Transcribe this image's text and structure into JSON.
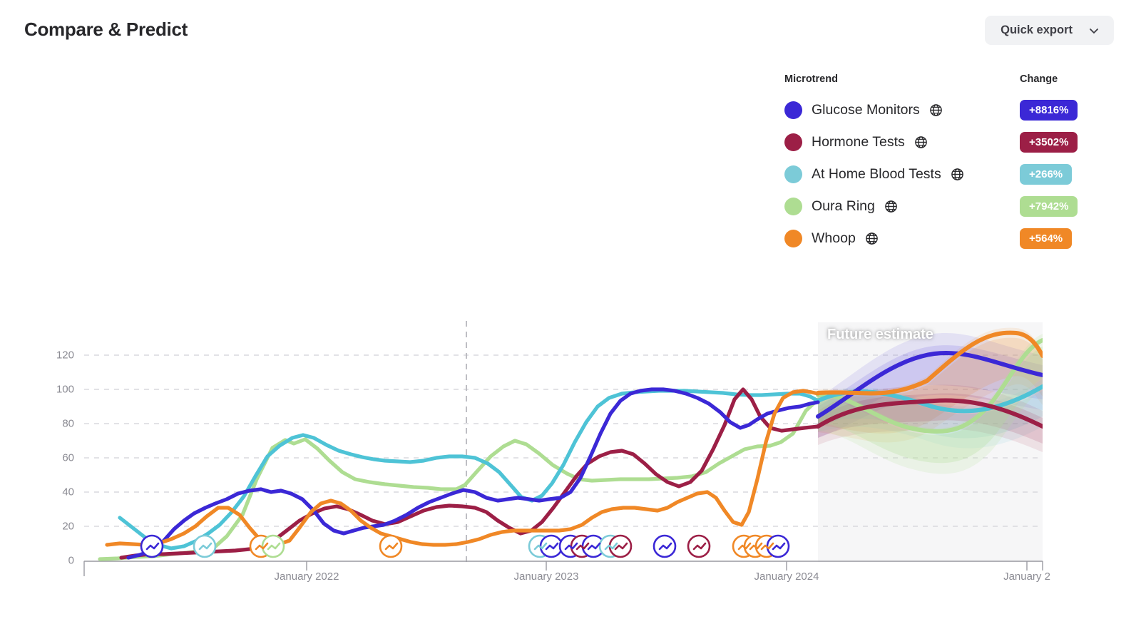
{
  "header": {
    "title": "Compare & Predict",
    "export_label": "Quick export",
    "export_icon": "chevron-down-icon"
  },
  "legend": {
    "col_trend": "Microtrend",
    "col_change": "Change",
    "globe_icon": "globe-icon",
    "items": [
      {
        "label": "Glucose Monitors",
        "color": "#3b28d6",
        "change": "+8816%",
        "chip_text_color": "#ffffff"
      },
      {
        "label": "Hormone Tests",
        "color": "#9c1f46",
        "change": "+3502%",
        "chip_text_color": "#ffffff"
      },
      {
        "label": "At Home Blood Tests",
        "color": "#7ccbd8",
        "change": "+266%",
        "chip_text_color": "#ffffff"
      },
      {
        "label": "Oura Ring",
        "color": "#aedd92",
        "change": "+7942%",
        "chip_text_color": "#ffffff"
      },
      {
        "label": "Whoop",
        "color": "#f08826",
        "change": "+564%",
        "chip_text_color": "#ffffff"
      }
    ]
  },
  "chart_data": {
    "type": "line",
    "title": "",
    "xlabel": "",
    "ylabel": "",
    "ylim": [
      0,
      130
    ],
    "yticks": [
      0,
      20,
      40,
      60,
      80,
      100,
      120
    ],
    "xticks": [
      "January 2022",
      "January 2023",
      "January 2024",
      "January 2"
    ],
    "grid": true,
    "legend_position": "top-right",
    "annotations": [
      {
        "text": "Future estimate",
        "type": "region-label"
      },
      {
        "text": "",
        "type": "vertical-dashed-marker"
      }
    ],
    "forecast_start": "mid 2024",
    "x": [
      "2021-06",
      "2021-07",
      "2021-08",
      "2021-09",
      "2021-10",
      "2021-11",
      "2021-12",
      "2022-01",
      "2022-02",
      "2022-03",
      "2022-04",
      "2022-05",
      "2022-06",
      "2022-07",
      "2022-08",
      "2022-09",
      "2022-10",
      "2022-11",
      "2022-12",
      "2023-01",
      "2023-02",
      "2023-03",
      "2023-04",
      "2023-05",
      "2023-06",
      "2023-07",
      "2023-08",
      "2023-09",
      "2023-10",
      "2023-11",
      "2023-12",
      "2024-01",
      "2024-02",
      "2024-03",
      "2024-04",
      "2024-05",
      "2024-06",
      "2024-07",
      "2024-08",
      "2024-09",
      "2024-10",
      "2024-11",
      "2024-12",
      "2025-01"
    ],
    "series": [
      {
        "name": "Glucose Monitors",
        "color": "#3b28d6",
        "values": [
          3,
          6,
          12,
          22,
          30,
          33,
          33,
          26,
          14,
          9,
          13,
          19,
          17,
          15,
          17,
          26,
          40,
          44,
          46,
          41,
          39,
          38,
          41,
          38,
          38,
          60,
          88,
          96,
          97,
          96,
          92,
          83,
          75,
          78,
          90,
          92,
          88,
          99,
          108,
          118,
          121,
          118,
          107,
          105
        ],
        "forecast_from": 36
      },
      {
        "name": "Hormone Tests",
        "color": "#9c1f46",
        "values": [
          2,
          4,
          4,
          5,
          6,
          6,
          7,
          6,
          6,
          8,
          12,
          18,
          24,
          27,
          30,
          26,
          22,
          20,
          18,
          17,
          19,
          20,
          17,
          12,
          11,
          18,
          30,
          52,
          68,
          72,
          66,
          52,
          47,
          65,
          88,
          100,
          82,
          78,
          92,
          97,
          100,
          97,
          95,
          86
        ],
        "forecast_from": 36
      },
      {
        "name": "At Home Blood Tests",
        "color": "#7ccbd8",
        "values": [
          25,
          18,
          12,
          13,
          16,
          21,
          26,
          30,
          45,
          62,
          72,
          68,
          60,
          58,
          58,
          54,
          56,
          58,
          58,
          56,
          50,
          38,
          33,
          44,
          72,
          95,
          99,
          100,
          99,
          99,
          98,
          97,
          96,
          94,
          97,
          100,
          96,
          93,
          90,
          91,
          93,
          92,
          91,
          100
        ],
        "forecast_from": 36
      },
      {
        "name": "Oura Ring",
        "color": "#aedd92",
        "values": [
          1,
          2,
          3,
          4,
          7,
          9,
          10,
          18,
          46,
          68,
          70,
          58,
          45,
          40,
          38,
          36,
          34,
          33,
          33,
          37,
          56,
          67,
          60,
          46,
          38,
          35,
          34,
          34,
          34,
          34,
          36,
          42,
          55,
          60,
          58,
          57,
          74,
          86,
          80,
          76,
          77,
          88,
          105,
          110
        ],
        "forecast_from": 36
      },
      {
        "name": "Whoop",
        "color": "#f08826",
        "values": [
          11,
          10,
          8,
          8,
          9,
          13,
          22,
          33,
          30,
          18,
          9,
          12,
          24,
          34,
          33,
          22,
          15,
          12,
          12,
          12,
          16,
          22,
          26,
          27,
          27,
          26,
          26,
          28,
          32,
          33,
          33,
          36,
          42,
          38,
          26,
          24,
          70,
          95,
          100,
          98,
          105,
          115,
          112,
          104
        ],
        "forecast_from": 36
      }
    ],
    "event_markers_note": "circular trend-glyph badges along baseline"
  }
}
